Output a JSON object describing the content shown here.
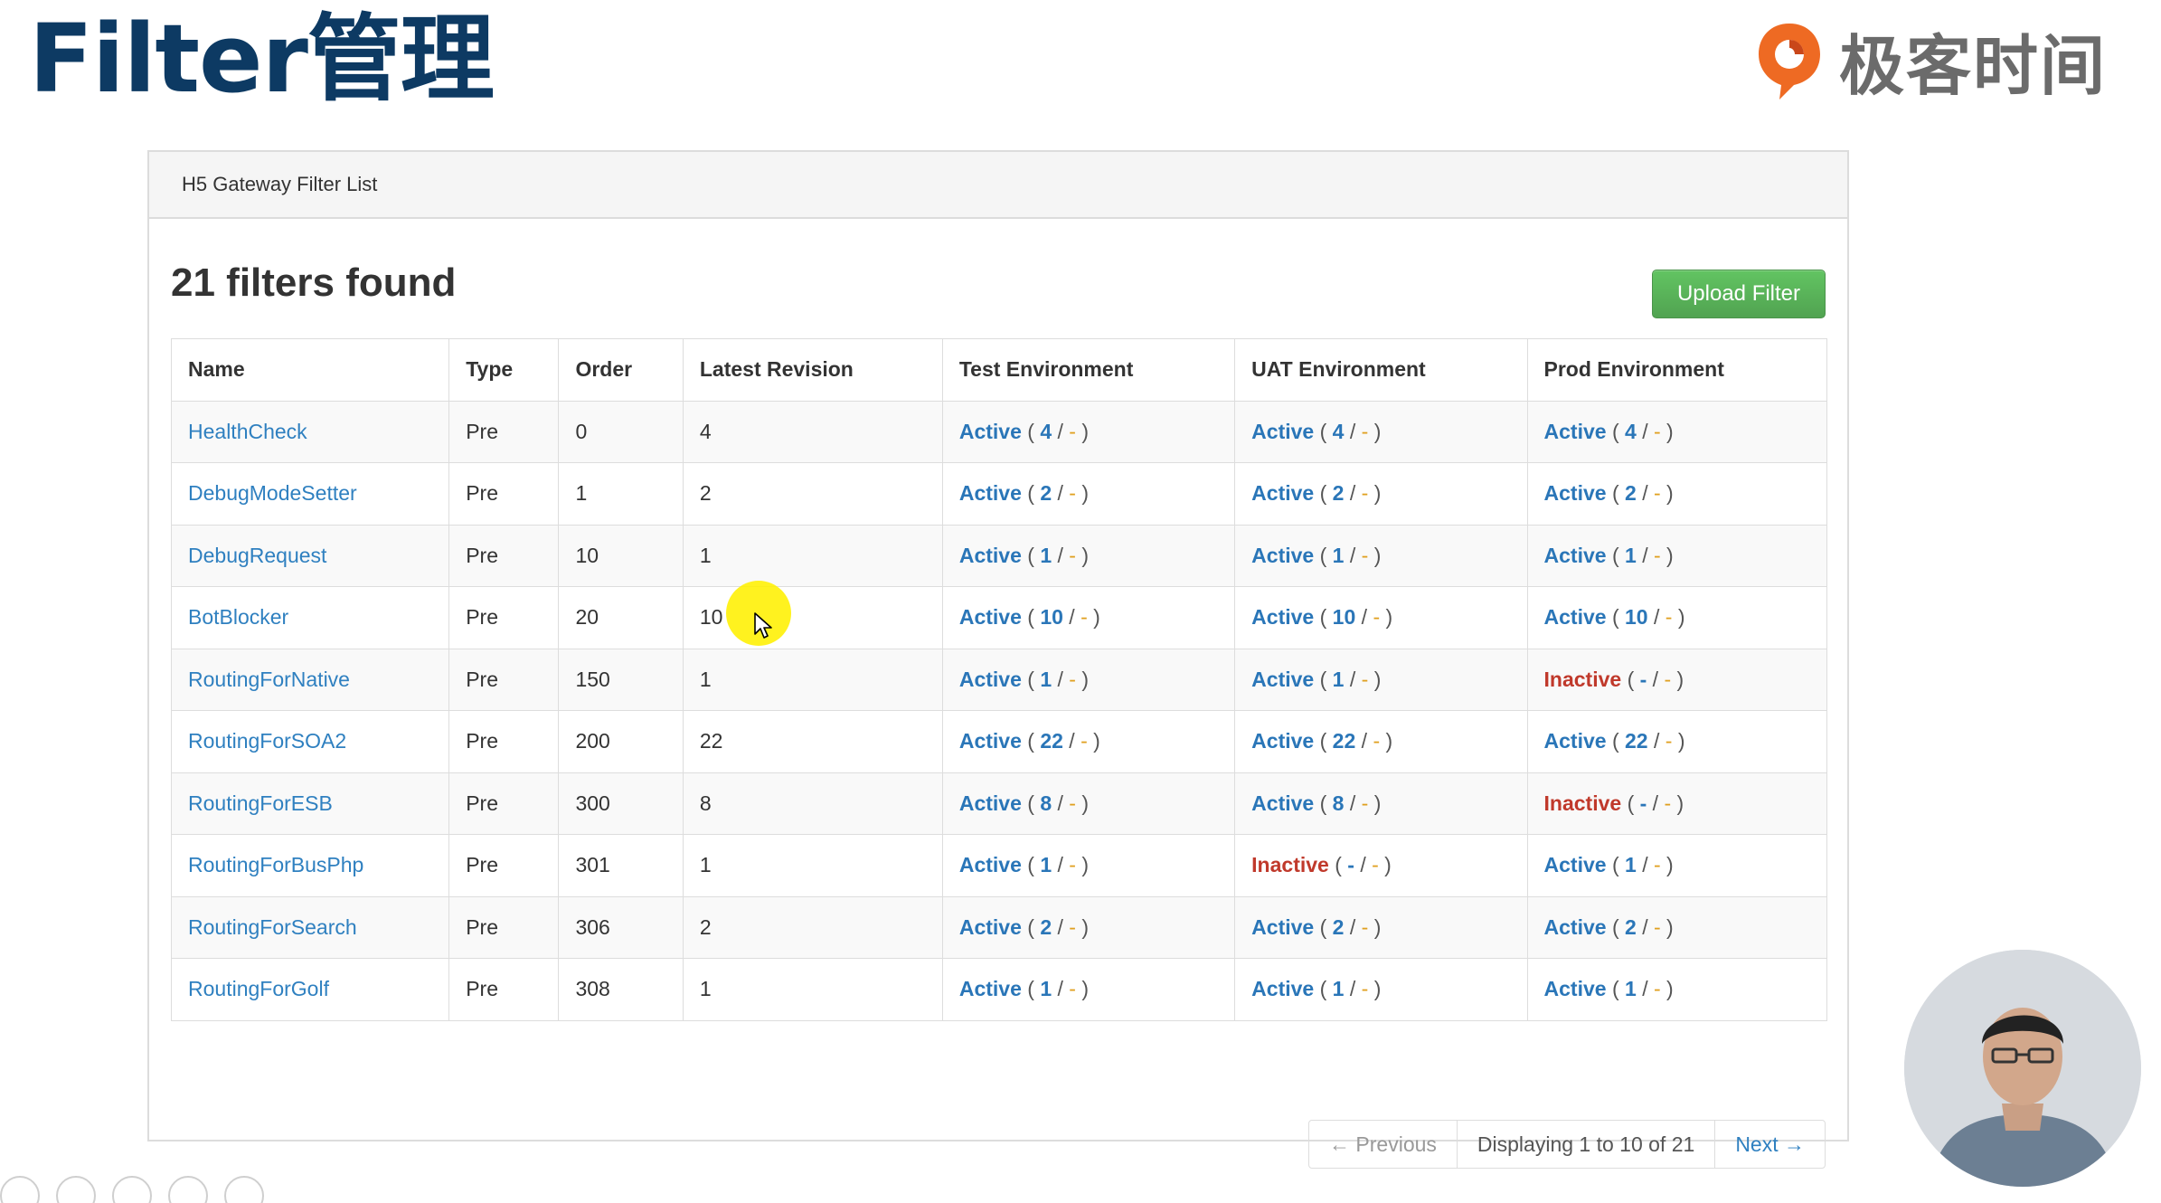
{
  "slide": {
    "title": "Filter管理"
  },
  "brand": {
    "name": "极客时间",
    "logo_icon": "geektime-logo-icon"
  },
  "panel": {
    "heading": "H5 Gateway Filter List",
    "found_text": "21 filters found",
    "upload_button": "Upload Filter"
  },
  "table": {
    "columns": [
      "Name",
      "Type",
      "Order",
      "Latest Revision",
      "Test Environment",
      "UAT Environment",
      "Prod Environment"
    ],
    "rows": [
      {
        "name": "HealthCheck",
        "type": "Pre",
        "order": "0",
        "rev": "4",
        "test": {
          "status": "Active",
          "rev": "4"
        },
        "uat": {
          "status": "Active",
          "rev": "4"
        },
        "prod": {
          "status": "Active",
          "rev": "4"
        }
      },
      {
        "name": "DebugModeSetter",
        "type": "Pre",
        "order": "1",
        "rev": "2",
        "test": {
          "status": "Active",
          "rev": "2"
        },
        "uat": {
          "status": "Active",
          "rev": "2"
        },
        "prod": {
          "status": "Active",
          "rev": "2"
        }
      },
      {
        "name": "DebugRequest",
        "type": "Pre",
        "order": "10",
        "rev": "1",
        "test": {
          "status": "Active",
          "rev": "1"
        },
        "uat": {
          "status": "Active",
          "rev": "1"
        },
        "prod": {
          "status": "Active",
          "rev": "1"
        }
      },
      {
        "name": "BotBlocker",
        "type": "Pre",
        "order": "20",
        "rev": "10",
        "test": {
          "status": "Active",
          "rev": "10"
        },
        "uat": {
          "status": "Active",
          "rev": "10"
        },
        "prod": {
          "status": "Active",
          "rev": "10"
        }
      },
      {
        "name": "RoutingForNative",
        "type": "Pre",
        "order": "150",
        "rev": "1",
        "test": {
          "status": "Active",
          "rev": "1"
        },
        "uat": {
          "status": "Active",
          "rev": "1"
        },
        "prod": {
          "status": "Inactive",
          "rev": "-"
        }
      },
      {
        "name": "RoutingForSOA2",
        "type": "Pre",
        "order": "200",
        "rev": "22",
        "test": {
          "status": "Active",
          "rev": "22"
        },
        "uat": {
          "status": "Active",
          "rev": "22"
        },
        "prod": {
          "status": "Active",
          "rev": "22"
        }
      },
      {
        "name": "RoutingForESB",
        "type": "Pre",
        "order": "300",
        "rev": "8",
        "test": {
          "status": "Active",
          "rev": "8"
        },
        "uat": {
          "status": "Active",
          "rev": "8"
        },
        "prod": {
          "status": "Inactive",
          "rev": "-"
        }
      },
      {
        "name": "RoutingForBusPhp",
        "type": "Pre",
        "order": "301",
        "rev": "1",
        "test": {
          "status": "Active",
          "rev": "1"
        },
        "uat": {
          "status": "Inactive",
          "rev": "-"
        },
        "prod": {
          "status": "Active",
          "rev": "1"
        }
      },
      {
        "name": "RoutingForSearch",
        "type": "Pre",
        "order": "306",
        "rev": "2",
        "test": {
          "status": "Active",
          "rev": "2"
        },
        "uat": {
          "status": "Active",
          "rev": "2"
        },
        "prod": {
          "status": "Active",
          "rev": "2"
        }
      },
      {
        "name": "RoutingForGolf",
        "type": "Pre",
        "order": "308",
        "rev": "1",
        "test": {
          "status": "Active",
          "rev": "1"
        },
        "uat": {
          "status": "Active",
          "rev": "1"
        },
        "prod": {
          "status": "Active",
          "rev": "1"
        }
      }
    ]
  },
  "pagination": {
    "previous": "← Previous",
    "info": "Displaying 1 to 10 of 21",
    "next": "Next →"
  },
  "colors": {
    "title": "#0d3a63",
    "link": "#2f80c0",
    "active": "#2a76b8",
    "inactive": "#c0392b",
    "upload_button": "#51a351"
  }
}
